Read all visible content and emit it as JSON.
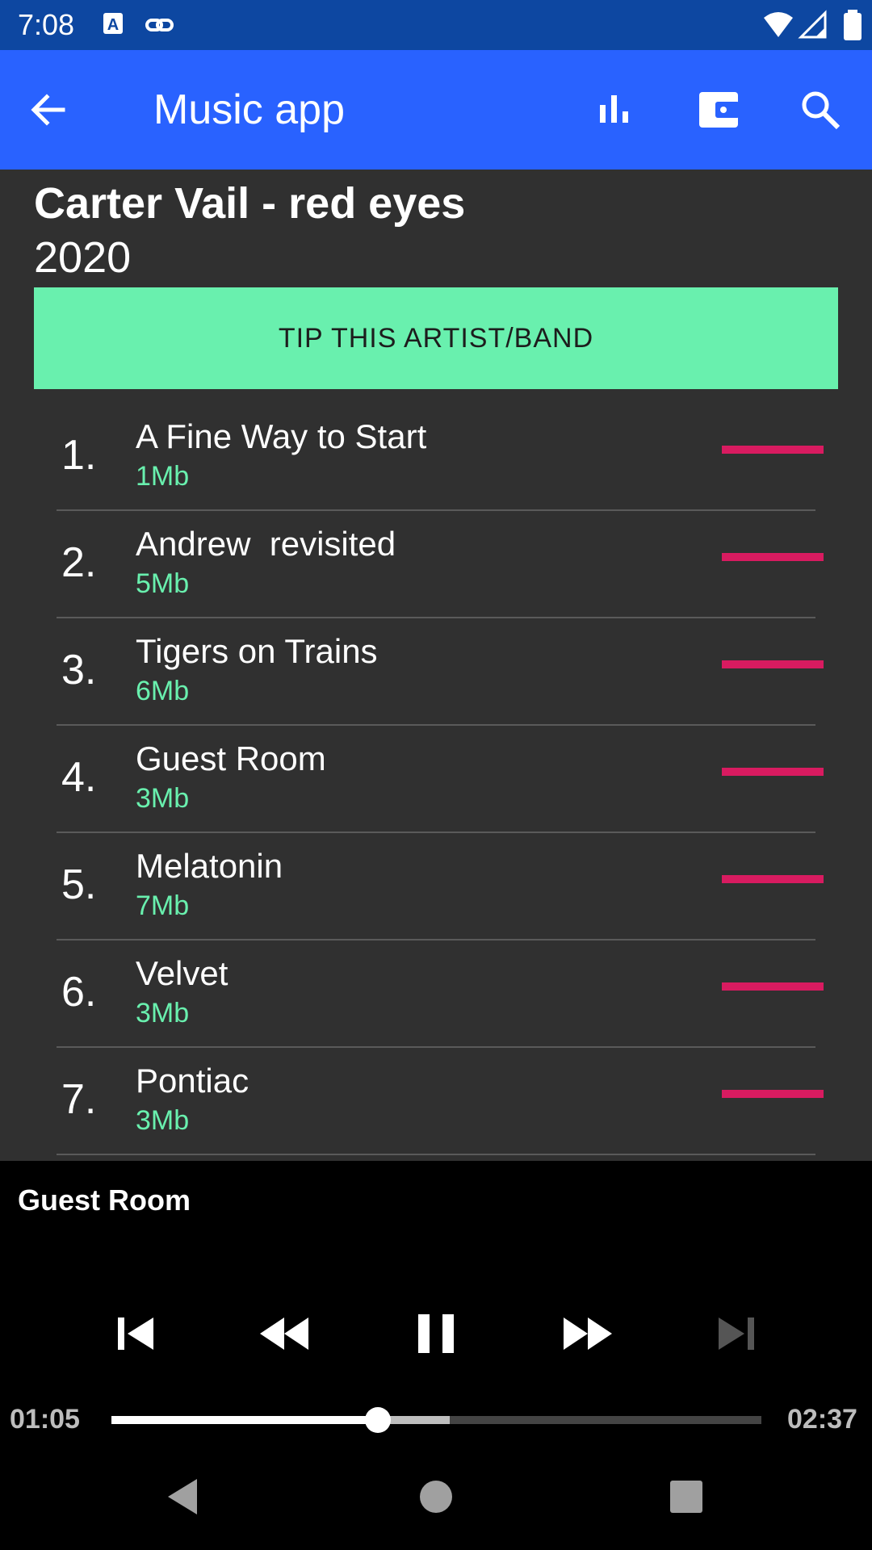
{
  "status_bar": {
    "time": "7:08",
    "icons": [
      "keyboard-a-icon",
      "link-icon",
      "wifi-icon",
      "signal-icon",
      "battery-icon"
    ]
  },
  "app_bar": {
    "title": "Music app",
    "actions": [
      "equalizer-icon",
      "wallet-icon",
      "search-icon"
    ]
  },
  "album": {
    "title": "Carter Vail - red eyes",
    "year": "2020",
    "tip_label": "TIP THIS ARTIST/BAND"
  },
  "tracks": [
    {
      "num": "1.",
      "name": "A Fine Way to Start",
      "size": "1Mb"
    },
    {
      "num": "2.",
      "name": "Andrew  revisited",
      "size": "5Mb"
    },
    {
      "num": "3.",
      "name": "Tigers on Trains",
      "size": "6Mb"
    },
    {
      "num": "4.",
      "name": "Guest Room",
      "size": "3Mb"
    },
    {
      "num": "5.",
      "name": "Melatonin",
      "size": "7Mb"
    },
    {
      "num": "6.",
      "name": "Velvet",
      "size": "3Mb"
    },
    {
      "num": "7.",
      "name": "Pontiac",
      "size": "3Mb"
    }
  ],
  "player": {
    "now_playing": "Guest Room",
    "elapsed": "01:05",
    "total": "02:37",
    "played_fraction": 0.41,
    "buffered_fraction": 0.52,
    "controls": [
      "skip-previous-icon",
      "rewind-icon",
      "pause-icon",
      "fast-forward-icon",
      "skip-next-icon"
    ]
  },
  "colors": {
    "status_bar": "#0d47a1",
    "app_bar": "#2962ff",
    "background": "#303030",
    "tip_button": "#69f0ae",
    "track_size": "#69f0ae",
    "track_bar": "#d81b60"
  }
}
